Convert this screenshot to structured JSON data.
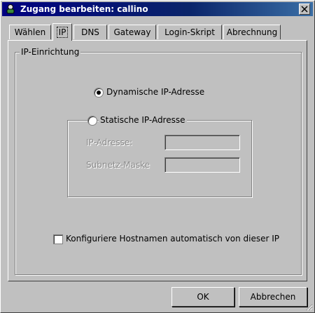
{
  "window": {
    "title": "Zugang bearbeiten: callino",
    "title_icon": "connection-icon",
    "close_icon": "close-icon"
  },
  "tabs": [
    {
      "label": "Wählen",
      "active": false
    },
    {
      "label": "IP",
      "active": true
    },
    {
      "label": "DNS",
      "active": false
    },
    {
      "label": "Gateway",
      "active": false
    },
    {
      "label": "Login-Skript",
      "active": false
    },
    {
      "label": "Abrechnung",
      "active": false
    }
  ],
  "ip_setup": {
    "group_label": "IP-Einrichtung",
    "dynamic_label": "Dynamische IP-Adresse",
    "dynamic_selected": true,
    "static_label": "Statische IP-Adresse",
    "static_selected": false,
    "ip_address_label": "IP-Adresse:",
    "ip_address_value": "",
    "subnet_mask_label": "Subnetz-Maske",
    "subnet_mask_value": "",
    "hostname_checkbox_label": "Konfiguriere Hostnamen automatisch von dieser IP",
    "hostname_checked": false
  },
  "buttons": {
    "ok": "OK",
    "cancel": "Abbrechen"
  }
}
